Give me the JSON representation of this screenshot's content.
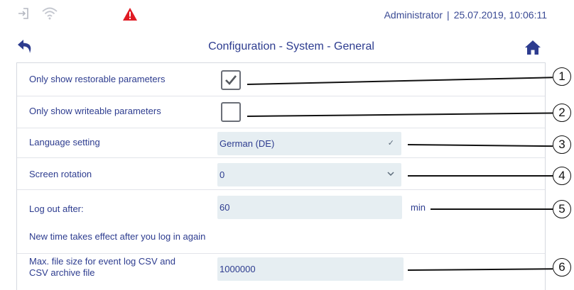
{
  "status": {
    "user": "Administrator",
    "datetime": "25.07.2019, 10:06:11",
    "icons": [
      "login-icon",
      "wifi-icon",
      "warning-icon"
    ],
    "warning_color": "#e01b24"
  },
  "nav": {
    "title": "Configuration - System - General",
    "icons": [
      "back-arrow-icon",
      "home-icon"
    ],
    "accent": "#2d3c8f"
  },
  "settings": {
    "restorable": {
      "label_prefix": "Only show ",
      "label_suffix": "restorable parameters",
      "checked": true
    },
    "writeable": {
      "label": "Only show writeable parameters",
      "checked": false
    },
    "language": {
      "label": "Language setting",
      "value": "German (DE)"
    },
    "rotation": {
      "label": "Screen rotation",
      "value": "0"
    },
    "logout": {
      "label": "Log out after:",
      "value": "60",
      "unit": "min"
    },
    "note": "New time takes effect after you log in again",
    "filesize": {
      "label_line1": "Max. file size for event log CSV and",
      "label_line2": "CSV archive file",
      "value": "1000000"
    }
  },
  "callouts": [
    "1",
    "2",
    "3",
    "4",
    "5",
    "6"
  ]
}
